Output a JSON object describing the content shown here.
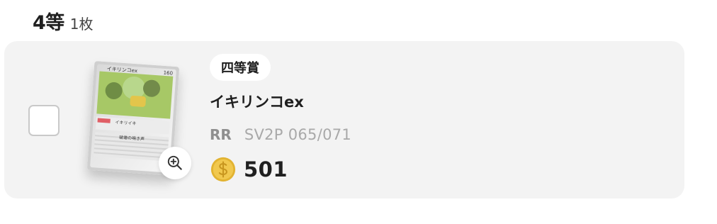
{
  "prize": {
    "rank": "4等",
    "count": "1枚",
    "badge": "四等賞"
  },
  "card": {
    "name": "イキリンコex",
    "rarity": "RR",
    "code": "SV2P 065/071",
    "points": "501",
    "image_text": {
      "title": "イキリンコex",
      "hp": "160",
      "ability": "イキリイキ",
      "attack": "破壊の鳴き声"
    }
  },
  "icons": {
    "zoom": "zoom-in-icon",
    "coin": "coin-icon",
    "checkbox": "checkbox"
  },
  "colors": {
    "row_background": "#f3f3f3",
    "checkbox_border": "#c9c9c9",
    "coin_gold": "#e2b331",
    "muted_text": "#8f8f8f"
  }
}
